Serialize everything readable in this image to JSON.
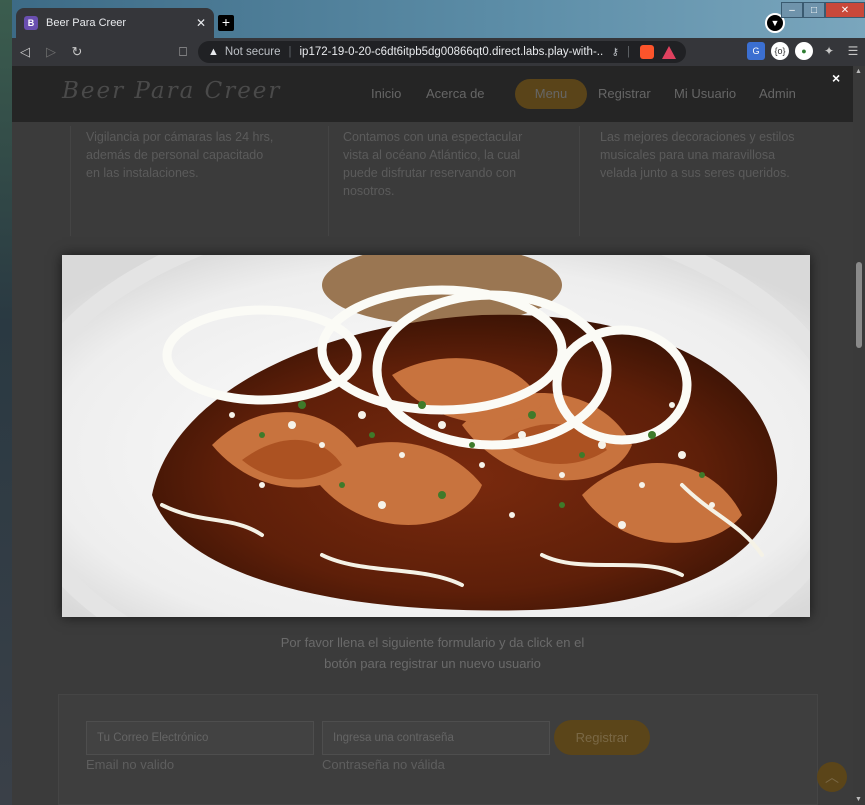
{
  "browser": {
    "tab_title": "Beer Para Creer",
    "tab_favicon": "B",
    "not_secure": "Not secure",
    "url": "ip172-19-0-20-c6dt6itpb5dg00866qt0.direct.labs.play-with-..."
  },
  "site": {
    "brand": "Beer Para Creer",
    "nav": {
      "inicio": "Inicio",
      "acerca": "Acerca de",
      "menu": "Menu",
      "registrar": "Registrar",
      "usuario": "Mi Usuario",
      "admin": "Admin"
    },
    "features": [
      "Vigilancia por cámaras las 24 hrs, además de personal capacitado en las instalaciones.",
      "Contamos con una espectacular vista al océano Atlántico, la cual puede disfrutar reservando con nosotros.",
      "Las mejores decoraciones y estilos musicales para una maravillosa velada junto a sus seres queridos."
    ],
    "register": {
      "subtitle_line1": "Por favor llena el siguiente formulario y da click en el",
      "subtitle_line2": "botón para registrar un nuevo usuario",
      "email_placeholder": "Tu Correo Electrónico",
      "password_placeholder": "Ingresa una contraseña",
      "button": "Registrar",
      "email_error": "Email no valido",
      "password_error": "Contraseña no válida"
    }
  },
  "lightbox": {
    "close": "×",
    "image_icon": "enchiladas-dish-image"
  },
  "colors": {
    "accent": "#b8892a",
    "overlay": "#3b3b3b"
  }
}
